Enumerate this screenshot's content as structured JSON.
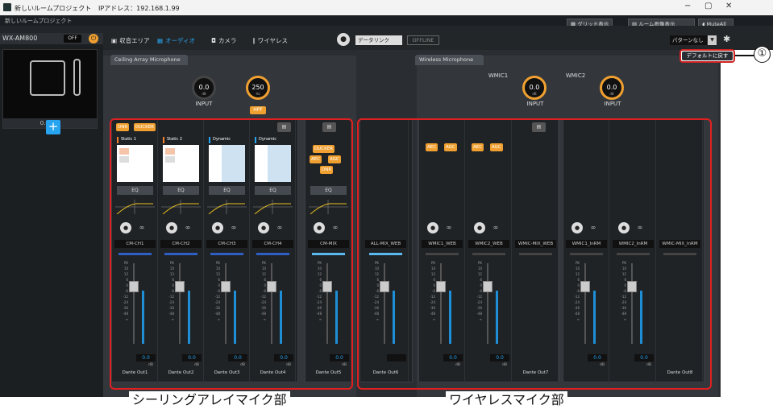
{
  "window": {
    "title": "新しいルームプロジェクト",
    "ip_label": "IPアドレス：192.168.1.99",
    "min": "−",
    "max": "▢",
    "close": "✕"
  },
  "menubar": {
    "label": "新しいルームプロジェクト"
  },
  "device": {
    "name": "WX-AM800",
    "off": "OFF",
    "ip": "0.0.0.0",
    "add": "+"
  },
  "top_buttons": {
    "grid": "グリッド表示",
    "room_image": "ルーム画像表示",
    "mute_all": "MuteAll"
  },
  "tabs": [
    {
      "label": "収音エリア",
      "icon": "▣"
    },
    {
      "label": "オーディオ",
      "icon": "▦"
    },
    {
      "label": "カメラ",
      "icon": "◘"
    },
    {
      "label": "ワイヤレス",
      "icon": "∥"
    }
  ],
  "datalink": "データリンク",
  "offline": "OFFLINE",
  "pattern": "パターンなし",
  "default_button": "デフォルトに戻す",
  "callout": "①",
  "ceiling": {
    "title": "Ceiling Array Microphone",
    "input": {
      "value": "0.0",
      "unit": "dB",
      "label": "INPUT"
    },
    "hpf": {
      "value": "250",
      "unit": "Hz",
      "label": "HPF"
    },
    "badges": [
      "DNR",
      "DUCKER"
    ],
    "mix_badges": [
      "DUCKER",
      "AEC",
      "AGC",
      "DNR"
    ],
    "channels": [
      {
        "tile": "Static 1",
        "eq": "EQ",
        "name": "CM-CH1",
        "value": "0.0",
        "db": "dB",
        "out": "Dante Out1",
        "type": "static"
      },
      {
        "tile": "Static 2",
        "eq": "EQ",
        "name": "CM-CH2",
        "value": "0.0",
        "db": "dB",
        "out": "Dante Out2",
        "type": "static"
      },
      {
        "tile": "Dynamic",
        "eq": "EQ",
        "name": "CM-CH3",
        "value": "0.0",
        "db": "dB",
        "out": "Dante Out3",
        "type": "dynamic"
      },
      {
        "tile": "Dynamic",
        "eq": "EQ",
        "name": "CM-CH4",
        "value": "0.0",
        "db": "dB",
        "out": "Dante Out4",
        "type": "dynamic"
      }
    ],
    "mix": {
      "eq": "EQ",
      "name": "CM-MIX",
      "value": "0.0",
      "db": "dB",
      "out": "Dante Out5"
    }
  },
  "allmix": {
    "name": "ALL-MIX_WEB",
    "out": "Dante Out6"
  },
  "wireless": {
    "title": "Wireless Microphone",
    "wmic1": {
      "label": "WMIC1",
      "value": "0.0",
      "unit": "dB",
      "input": "INPUT"
    },
    "wmic2": {
      "label": "WMIC2",
      "value": "0.0",
      "unit": "dB",
      "input": "INPUT"
    },
    "badges": [
      "AEC",
      "AGC"
    ],
    "web": [
      {
        "name": "WMIC1_WEB",
        "value": "0.0",
        "db": "dB"
      },
      {
        "name": "WMIC2_WEB",
        "value": "0.0",
        "db": "dB"
      },
      {
        "name": "WMIC-MIX_WEB",
        "out": "Dante Out7"
      }
    ],
    "inrm": [
      {
        "name": "WMIC1_InRM",
        "value": "0.0",
        "db": "dB"
      },
      {
        "name": "WMIC2_InRM",
        "value": "0.0",
        "db": "dB"
      },
      {
        "name": "WMIC-MIX_InRM",
        "out": "Dante Out8"
      }
    ]
  },
  "fader_scale": [
    "PK",
    "10",
    "12",
    "6",
    "0",
    "-6",
    "-12",
    "-24",
    "-36",
    "-48",
    "∞"
  ],
  "bottom": {
    "ceiling_label": "シーリングアレイマイク部",
    "wireless_label": "ワイヤレスマイク部"
  },
  "colors": {
    "accent": "#f0a030",
    "blue": "#27a4f0",
    "frame": "#e02020"
  }
}
